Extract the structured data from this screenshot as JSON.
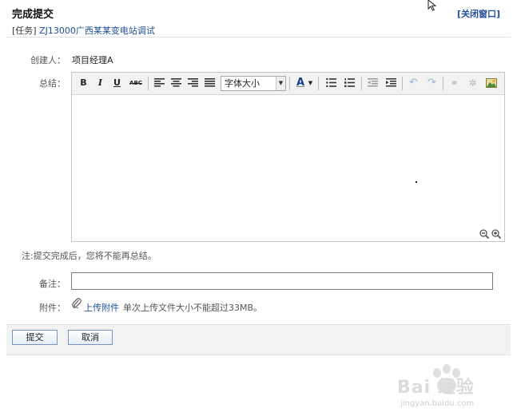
{
  "header": {
    "title": "完成提交",
    "close_label": "[关闭窗口]",
    "task_prefix": "[任务]",
    "task_name": "ZJ13000广西某某变电站调试"
  },
  "form": {
    "creator_label": "创建人：",
    "creator_value": "项目经理A",
    "summary_label": "总结：",
    "note": "注:提交完成后，您将不能再总结。",
    "remark_label": "备注：",
    "remark_value": "",
    "attachment_label": "附件：",
    "upload_label": "上传附件",
    "upload_hint": "单次上传文件大小不能超过33MB。"
  },
  "editor": {
    "bold": "B",
    "italic": "I",
    "underline": "U",
    "strike": "ABC",
    "font_size_placeholder": "字体大小",
    "font_color": "A"
  },
  "buttons": {
    "submit": "提交",
    "cancel": "取消"
  },
  "watermark": {
    "text": "Bai 经验",
    "url": "jingyan.baidu.com"
  }
}
